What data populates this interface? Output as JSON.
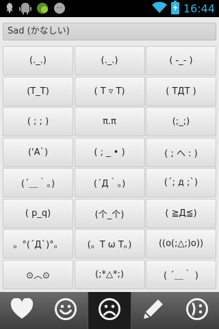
{
  "status_bar": {
    "time": "16:44",
    "icons": [
      "usb-debug-icon",
      "android-icon",
      "app-notification-icon",
      "emoji-notification-icon",
      "wifi-icon",
      "battery-charging-icon"
    ]
  },
  "category": {
    "title": "Sad (かなしい)"
  },
  "emoticons": [
    "(._.)",
    "(._.)",
    "( -_- )",
    "(T_T)",
    "( T ▿ T)",
    "( TДT )",
    "( ; ; )",
    "π.π",
    "(;_;)",
    "('A`)",
    "( ; _ • )",
    "( ; へ : )",
    "(´＿｀。)",
    "(´Д｀。)",
    "(´; д ;`)",
    "( p_q)",
    "(个_个)",
    "( ≧Д≦)",
    "。°(´Д`)°。",
    "(。T ω T。)",
    "((o(;△;)o))",
    "⊙︿⊙",
    "(;*△*;)",
    "( ´＿｀ )"
  ],
  "tabs": [
    {
      "name": "favorites",
      "icon": "heart-icon"
    },
    {
      "name": "happy",
      "icon": "smile-icon"
    },
    {
      "name": "sad",
      "icon": "frown-icon",
      "active": true
    },
    {
      "name": "edit",
      "icon": "pencil-icon"
    },
    {
      "name": "wink",
      "icon": "wink-icon"
    }
  ]
}
